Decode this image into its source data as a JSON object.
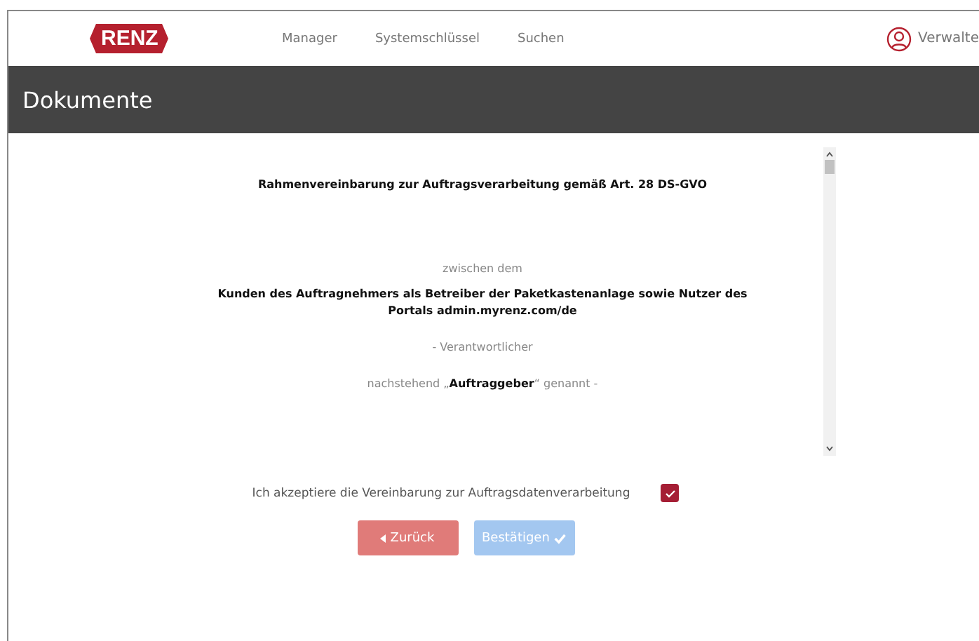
{
  "header": {
    "logo": "RENZ",
    "nav": [
      {
        "label": "Manager"
      },
      {
        "label": "Systemschlüssel"
      },
      {
        "label": "Suchen"
      }
    ],
    "user": "Verwalte"
  },
  "page_title": "Dokumente",
  "document": {
    "title": "Rahmenvereinbarung zur Auftragsverarbeitung gemäß Art. 28 DS-GVO",
    "paragraphs": [
      {
        "kind": "plain",
        "text": "zwischen dem"
      },
      {
        "kind": "bold",
        "text": "Kunden des Auftragnehmers als Betreiber der Paketkastenanlage sowie Nutzer des Portals admin.myrenz.com/de"
      },
      {
        "kind": "plain",
        "text": "- Verantwortlicher"
      },
      {
        "kind": "plain",
        "text": "nachstehend „**Auftraggeber**“ genannt -"
      }
    ]
  },
  "consent": {
    "label": "Ich akzeptiere die Vereinbarung zur Auftragsdatenverarbeitung",
    "checked": true
  },
  "buttons": [
    {
      "kind": "back",
      "label": "Zurück",
      "disabled": false
    },
    {
      "kind": "confirm",
      "label": "Bestätigen",
      "disabled": true
    }
  ]
}
